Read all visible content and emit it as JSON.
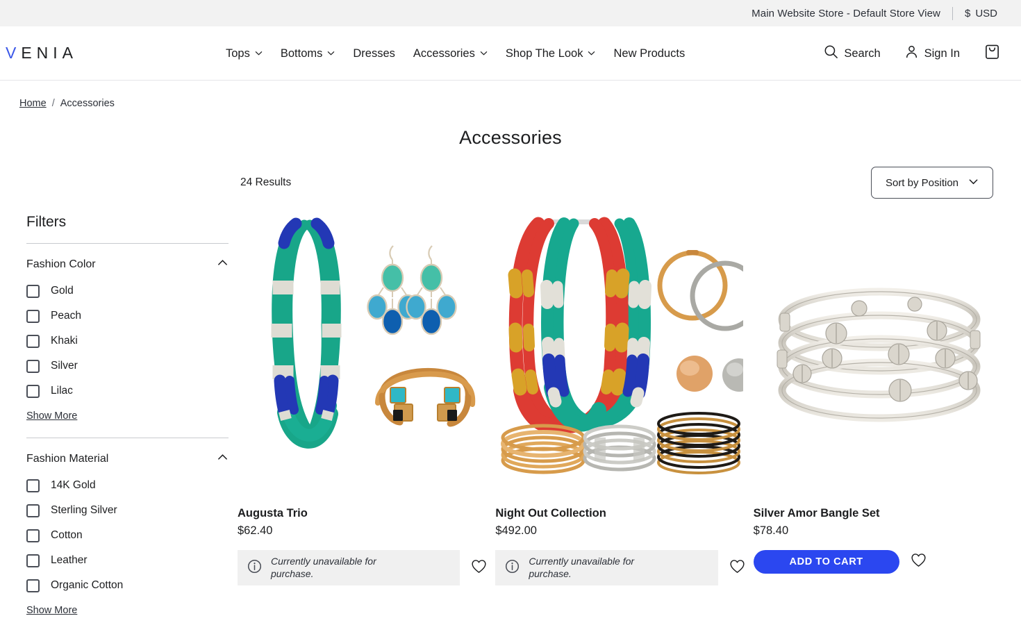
{
  "store_bar": {
    "store_switcher": "Main Website Store - Default Store View",
    "currency_symbol": "$",
    "currency_code": "USD"
  },
  "header": {
    "logo_first_letter": "V",
    "logo_rest": "ENIA",
    "nav": [
      {
        "label": "Tops",
        "has_dropdown": true
      },
      {
        "label": "Bottoms",
        "has_dropdown": true
      },
      {
        "label": "Dresses",
        "has_dropdown": false
      },
      {
        "label": "Accessories",
        "has_dropdown": true
      },
      {
        "label": "Shop The Look",
        "has_dropdown": true
      },
      {
        "label": "New Products",
        "has_dropdown": false
      }
    ],
    "search_label": "Search",
    "signin_label": "Sign In",
    "cart_icon": "shopping-bag-icon"
  },
  "breadcrumb": {
    "home": "Home",
    "separator": "/",
    "current": "Accessories"
  },
  "page": {
    "title": "Accessories"
  },
  "toolbar": {
    "results_count": "24 Results",
    "sort_label": "Sort by Position"
  },
  "filters": {
    "title": "Filters",
    "groups": [
      {
        "name": "Fashion Color",
        "expanded": true,
        "options": [
          "Gold",
          "Peach",
          "Khaki",
          "Silver",
          "Lilac"
        ],
        "show_more": "Show More"
      },
      {
        "name": "Fashion Material",
        "expanded": true,
        "options": [
          "14K Gold",
          "Sterling Silver",
          "Cotton",
          "Leather",
          "Organic Cotton"
        ],
        "show_more": "Show More"
      }
    ]
  },
  "products": [
    {
      "name": "Augusta Trio",
      "price": "$62.40",
      "available": false,
      "unavailable_message": "Currently unavailable for purchase.",
      "image_alt": "teal and blue beaded necklace with drop earrings and gold cuff bracelet"
    },
    {
      "name": "Night Out Collection",
      "price": "$492.00",
      "available": false,
      "unavailable_message": "Currently unavailable for purchase.",
      "image_alt": "red teal and blue beaded necklaces with gold hoop earrings studs and bangles"
    },
    {
      "name": "Silver Amor Bangle Set",
      "price": "$78.40",
      "available": true,
      "add_to_cart_label": "ADD TO CART",
      "image_alt": "stack of four silver bangles with screw accents"
    }
  ],
  "colors": {
    "accent_blue": "#2B47F0",
    "logo_blue": "#3A57E8",
    "text_dark": "#1C1D1F",
    "store_bar_bg": "#F2F2F2",
    "unavailable_bg": "#F0F0F0"
  }
}
